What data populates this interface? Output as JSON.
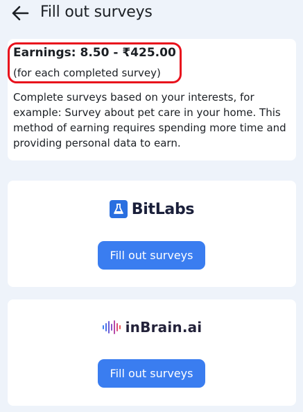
{
  "header": {
    "title": "Fill out surveys",
    "back_icon": "arrow-left-icon"
  },
  "info": {
    "earnings": "Earnings: 8.50 - ₹425.00",
    "earnings_note": "(for each completed survey)",
    "description": "Complete surveys based on your interests, for example: Survey about pet care in your home. This method of earning requires spending more time and providing personal data to earn.",
    "highlight_color": "#e8101c"
  },
  "providers": [
    {
      "name": "BitLabs",
      "logo_text": "BitLabs",
      "logo_icon": "flask-icon",
      "button_label": "Fill out surveys"
    },
    {
      "name": "inBrain.ai",
      "logo_text": "inBrain.ai",
      "logo_icon": "waveform-icon",
      "button_label": "Fill out surveys"
    }
  ],
  "colors": {
    "background": "#eef3fa",
    "card": "#ffffff",
    "accent": "#3a7df0",
    "brand_bitlabs": "#2a6fe0"
  }
}
